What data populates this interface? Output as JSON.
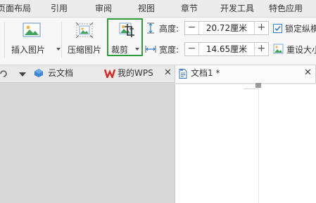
{
  "menu": {
    "tabs": [
      "页面布局",
      "引用",
      "审阅",
      "视图",
      "章节",
      "开发工具",
      "特色应用"
    ]
  },
  "ribbon": {
    "insert_picture": "插入图片",
    "compress_picture": "压缩图片",
    "crop": "裁剪",
    "height_label": "高度:",
    "height_value": "20.72厘米",
    "width_label": "宽度:",
    "width_value": "14.65厘米",
    "lock_ratio_label": "锁定纵横",
    "reset_size_label": "重设大小"
  },
  "tabstrip": {
    "tabs": [
      {
        "label": "云文档"
      },
      {
        "label": "我的WPS"
      },
      {
        "label": "文档1 *"
      }
    ]
  },
  "colors": {
    "crop_highlight": "#2e9b3b",
    "wps_red": "#d9281e",
    "cloud_blue": "#3a85d6",
    "doc_blue": "#2f6fc8"
  }
}
